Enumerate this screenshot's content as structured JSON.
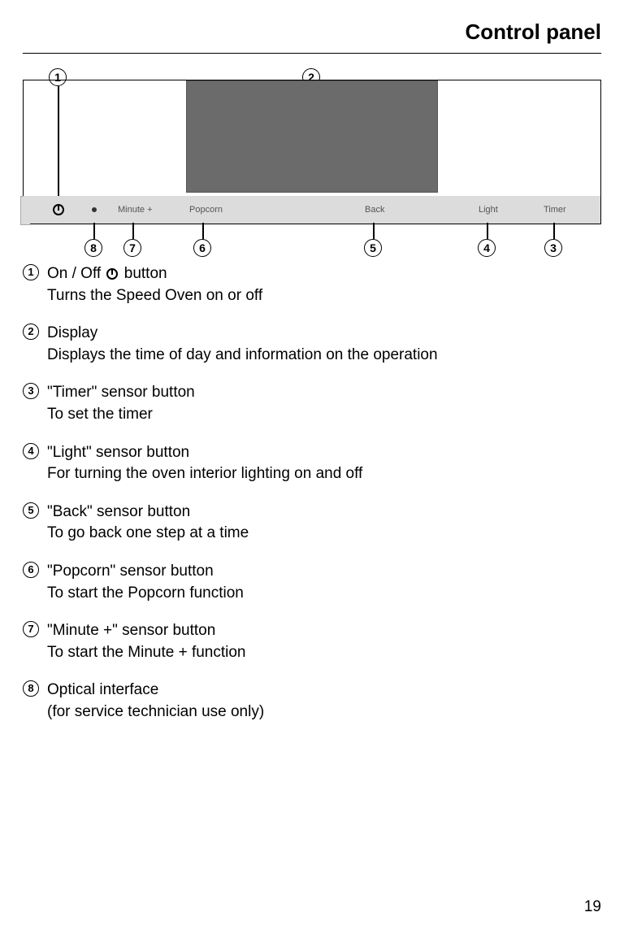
{
  "header": {
    "title": "Control panel"
  },
  "panel": {
    "labels": {
      "minute": "Minute +",
      "popcorn": "Popcorn",
      "back": "Back",
      "light": "Light",
      "timer": "Timer"
    }
  },
  "callouts": {
    "c1": "1",
    "c2": "2",
    "c3": "3",
    "c4": "4",
    "c5": "5",
    "c6": "6",
    "c7": "7",
    "c8": "8"
  },
  "legend": [
    {
      "num": "1",
      "title_pre": "On / Off ",
      "title_post": " button",
      "desc": "Turns the Speed Oven on or off",
      "power": true
    },
    {
      "num": "2",
      "title": "Display",
      "desc": "Displays the time of day and information on the operation"
    },
    {
      "num": "3",
      "title": "\"Timer\" sensor button",
      "desc": "To set the timer"
    },
    {
      "num": "4",
      "title": "\"Light\" sensor button",
      "desc": "For turning the oven interior lighting on and off"
    },
    {
      "num": "5",
      "title": "\"Back\" sensor button",
      "desc": "To go back one step at a time"
    },
    {
      "num": "6",
      "title": "\"Popcorn\" sensor button",
      "desc": "To start the Popcorn function"
    },
    {
      "num": "7",
      "title": "\"Minute +\" sensor button",
      "desc": "To start the Minute + function"
    },
    {
      "num": "8",
      "title": "Optical interface",
      "desc": "(for service technician use only)"
    }
  ],
  "page_number": "19"
}
